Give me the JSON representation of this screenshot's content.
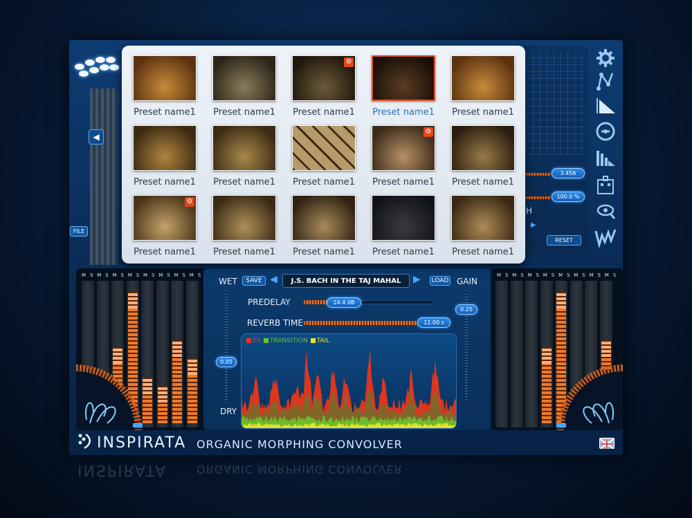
{
  "brand": {
    "name": "INSPIRATA",
    "tagline": "ORGANIC MORPHING CONVOLVER"
  },
  "buttons": {
    "file": "FILE",
    "save": "SAVE",
    "load": "LOAD",
    "reset": "RESET"
  },
  "right_panel": {
    "value1": "3.456",
    "value2": "100.0 %",
    "partial_label": "H"
  },
  "presets": [
    {
      "label": "Preset name1",
      "selected": false,
      "has_gear": false
    },
    {
      "label": "Preset name1",
      "selected": false,
      "has_gear": false
    },
    {
      "label": "Preset name1",
      "selected": false,
      "has_gear": true
    },
    {
      "label": "Preset name1",
      "selected": true,
      "has_gear": false
    },
    {
      "label": "Preset name1",
      "selected": false,
      "has_gear": false
    },
    {
      "label": "Preset name1",
      "selected": false,
      "has_gear": false
    },
    {
      "label": "Preset name1",
      "selected": false,
      "has_gear": false
    },
    {
      "label": "Preset name1",
      "selected": false,
      "has_gear": false
    },
    {
      "label": "Preset name1",
      "selected": false,
      "has_gear": true
    },
    {
      "label": "Preset name1",
      "selected": false,
      "has_gear": false
    },
    {
      "label": "Preset name1",
      "selected": false,
      "has_gear": true
    },
    {
      "label": "Preset name1",
      "selected": false,
      "has_gear": false
    },
    {
      "label": "Preset name1",
      "selected": false,
      "has_gear": false
    },
    {
      "label": "Preset name1",
      "selected": false,
      "has_gear": false
    },
    {
      "label": "Preset name1",
      "selected": false,
      "has_gear": false
    }
  ],
  "center": {
    "wet": "WET",
    "dry": "DRY",
    "gain": "GAIN",
    "current_preset": "J.S. BACH IN THE TAJ MAHAL",
    "wet_value": "0.05",
    "gain_value": "0.25",
    "predelay_label": "PREDELAY",
    "predelay_value": "24.4 dB",
    "predelay_level": 0.25,
    "reverb_label": "REVERB TIME",
    "reverb_value": "12.00 s",
    "reverb_level": 0.9
  },
  "graph": {
    "legend": [
      {
        "name": "ER",
        "color": "#e8361a"
      },
      {
        "name": "TRANSITION",
        "color": "#6bbf2a"
      },
      {
        "name": "TAIL",
        "color": "#e9e32a"
      }
    ]
  },
  "meters": {
    "header": [
      "M",
      "S",
      "M",
      "S",
      "M",
      "S",
      "M",
      "S",
      "M",
      "S",
      "M",
      "S",
      "M",
      "S",
      "M",
      "S"
    ],
    "left_levels": [
      0,
      0,
      0.55,
      0.95,
      0.33,
      0.27,
      0.6,
      0.47
    ],
    "right_levels": [
      0,
      0,
      0,
      0.55,
      0.95,
      0,
      0,
      0.6
    ]
  },
  "colors": {
    "accent": "#f07a2a",
    "panel": "#0d3c72",
    "highlight": "#2b8bea"
  }
}
